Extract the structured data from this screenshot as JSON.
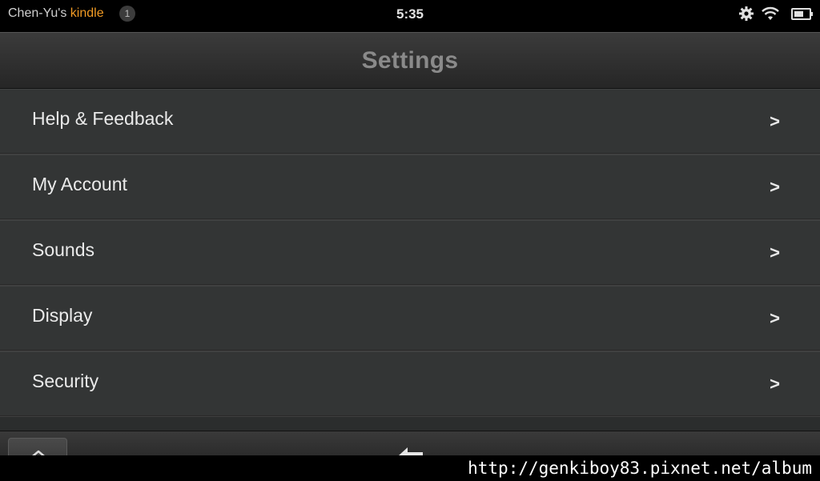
{
  "status_bar": {
    "owner": "Chen-Yu's",
    "brand": "kindle",
    "notification_count": "1",
    "time": "5:35"
  },
  "header": {
    "title": "Settings"
  },
  "settings": {
    "items": [
      {
        "label": "Help & Feedback",
        "chevron": ">"
      },
      {
        "label": "My Account",
        "chevron": ">"
      },
      {
        "label": "Sounds",
        "chevron": ">"
      },
      {
        "label": "Display",
        "chevron": ">"
      },
      {
        "label": "Security",
        "chevron": ">"
      }
    ]
  },
  "watermark": {
    "text": "http://genkiboy83.pixnet.net/album"
  },
  "icons": {
    "status": [
      "gear-icon",
      "wifi-icon",
      "battery-icon"
    ],
    "nav": [
      "home-icon",
      "back-arrow-icon"
    ]
  },
  "colors": {
    "brand_accent": "#f09a24",
    "background": "#2b2d2d"
  }
}
